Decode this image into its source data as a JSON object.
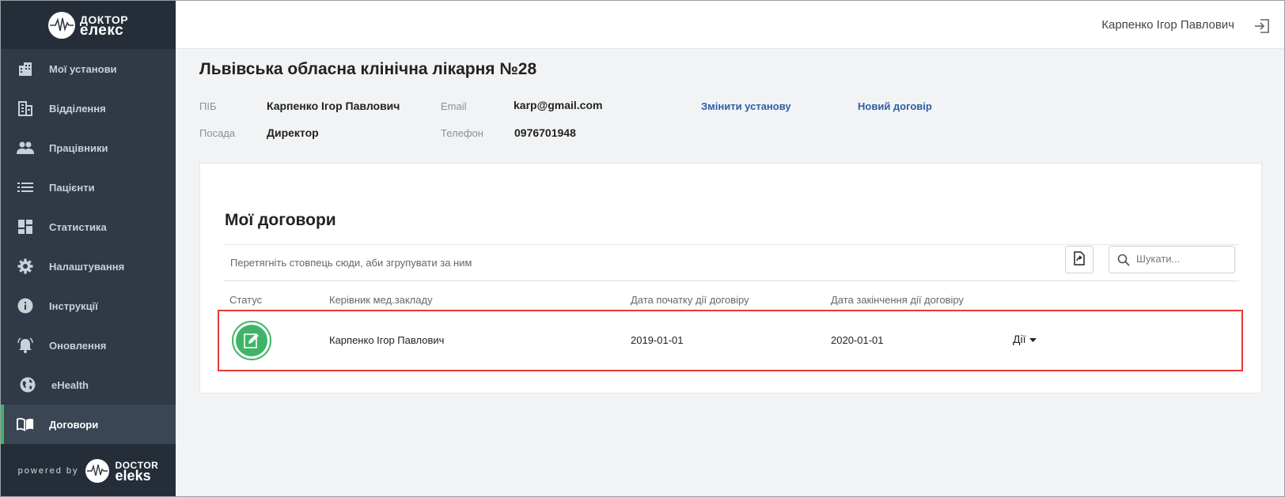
{
  "brand": {
    "logo_line1": "ДОКТОР",
    "logo_line2": "елекс"
  },
  "sidebar": {
    "items": [
      {
        "label": "Мої установи",
        "icon": "building-icon",
        "active": false
      },
      {
        "label": "Відділення",
        "icon": "department-icon",
        "active": false
      },
      {
        "label": "Працівники",
        "icon": "people-icon",
        "active": false
      },
      {
        "label": "Пацієнти",
        "icon": "list-icon",
        "active": false
      },
      {
        "label": "Статистика",
        "icon": "dashboard-icon",
        "active": false
      },
      {
        "label": "Налаштування",
        "icon": "gear-icon",
        "active": false
      },
      {
        "label": "Інструкції",
        "icon": "info-icon",
        "active": false
      },
      {
        "label": "Оновлення",
        "icon": "bell-icon",
        "active": false
      },
      {
        "label": "eHealth",
        "icon": "globe-icon",
        "active": false
      },
      {
        "label": "Договори",
        "icon": "book-icon",
        "active": true
      }
    ],
    "powered_by": "powered by",
    "footer_brand_line1": "DOCTOR",
    "footer_brand_line2": "eleks"
  },
  "header": {
    "user_name": "Карпенко Ігор Павлович",
    "logout_icon": "logout-icon"
  },
  "institution": {
    "title": "Львівська обласна клінічна лікарня №28",
    "fields": {
      "name_label": "ПІБ",
      "name_value": "Карпенко Ігор Павлович",
      "position_label": "Посада",
      "position_value": "Директор",
      "email_label": "Email",
      "email_value": "karp@gmail.com",
      "phone_label": "Телефон",
      "phone_value": "0976701948"
    },
    "change_link": "Змінити установу",
    "new_contract_link": "Новий договір"
  },
  "contracts": {
    "title": "Мої договори",
    "group_hint": "Перетягніть стовпець сюди, аби згрупувати за ним",
    "search_placeholder": "Шукати...",
    "columns": [
      "Статус",
      "Керівник мед.закладу",
      "Дата початку дії договіру",
      "Дата закінчення дії договіру"
    ],
    "rows": [
      {
        "status_icon": "edit-document-icon",
        "head": "Карпенко Ігор Павлович",
        "start": "2019-01-01",
        "end": "2020-01-01",
        "actions": "Дії"
      }
    ],
    "status_color": "#3fb466",
    "highlight_color": "#e53935"
  }
}
